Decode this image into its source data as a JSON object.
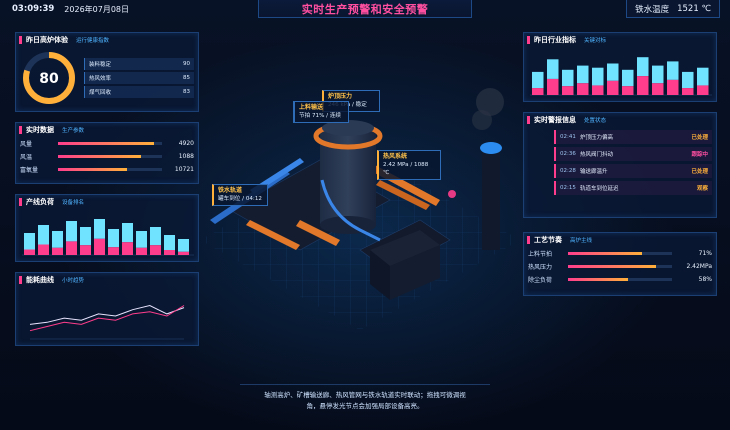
{
  "header": {
    "time": "03:09:39",
    "date": "2026年07月08日",
    "title": "实时生产预警和安全预警",
    "temp_label": "铁水温度",
    "temp_value": "1521 ℃"
  },
  "health": {
    "title": "昨日高炉体验",
    "subtitle": "运行健康指数",
    "score": "80",
    "score_fraction": 0.8,
    "items": [
      {
        "label": "装料稳定",
        "value": "90"
      },
      {
        "label": "热风效率",
        "value": "85"
      },
      {
        "label": "煤气回收",
        "value": "83"
      }
    ]
  },
  "realtime": {
    "title": "实时数据",
    "subtitle": "生产参数",
    "items": [
      {
        "label": "风量",
        "value": "4920",
        "level": 0.92
      },
      {
        "label": "风温",
        "value": "1088",
        "level": 0.8
      },
      {
        "label": "富氧量",
        "value": "10721",
        "level": 0.66
      }
    ]
  },
  "load": {
    "title": "产线负荷",
    "subtitle": "设备排名",
    "bars": [
      0.55,
      0.75,
      0.6,
      0.85,
      0.7,
      0.9,
      0.65,
      0.8,
      0.6,
      0.7,
      0.5,
      0.4
    ],
    "tops": [
      0.25,
      0.35,
      0.3,
      0.4,
      0.35,
      0.45,
      0.3,
      0.4,
      0.3,
      0.35,
      0.25,
      0.2
    ]
  },
  "energy": {
    "title": "能耗曲线",
    "subtitle": "小时趋势",
    "pink": [
      0.15,
      0.25,
      0.35,
      0.3,
      0.45,
      0.4,
      0.55,
      0.6,
      0.5,
      0.75
    ],
    "blue": [
      0.3,
      0.35,
      0.45,
      0.4,
      0.55,
      0.5,
      0.65,
      0.75,
      0.55,
      0.7
    ]
  },
  "industry": {
    "title": "昨日行业指标",
    "subtitle": "关键对标",
    "bars": [
      0.55,
      0.85,
      0.6,
      0.7,
      0.65,
      0.75,
      0.6,
      0.9,
      0.7,
      0.8,
      0.55,
      0.65
    ],
    "tops": [
      0.3,
      0.45,
      0.35,
      0.4,
      0.35,
      0.45,
      0.35,
      0.5,
      0.4,
      0.45,
      0.3,
      0.35
    ]
  },
  "alarms": {
    "title": "实时警报信息",
    "subtitle": "处置状态",
    "items": [
      {
        "time": "02:41",
        "msg": "炉顶压力偏高",
        "status": "已处理",
        "color": "#ffb03a"
      },
      {
        "time": "02:36",
        "msg": "热风阀门抖动",
        "status": "跟踪中",
        "color": "#ff4fa0"
      },
      {
        "time": "02:28",
        "msg": "输送廊温升",
        "status": "已处理",
        "color": "#ffb03a"
      },
      {
        "time": "02:15",
        "msg": "轨道车到位延迟",
        "status": "观察",
        "color": "#ffb03a"
      }
    ]
  },
  "process": {
    "title": "工艺节奏",
    "subtitle": "高炉主线",
    "items": [
      {
        "label": "上料节拍",
        "value": "71%",
        "level": 0.71
      },
      {
        "label": "热风压力",
        "value": "2.42MPa",
        "level": 0.85
      },
      {
        "label": "除尘负荷",
        "value": "58%",
        "level": 0.58
      }
    ]
  },
  "callouts": {
    "top_pressure": {
      "title": "炉顶压力",
      "line1": "246 kPa / 稳定"
    },
    "feed": {
      "title": "上料输送",
      "line1": "节拍 71% / 连续"
    },
    "hot_air": {
      "title": "热风系统",
      "line1": "2.42 MPa / 1088 ℃"
    },
    "rail": {
      "title": "铁水轨道",
      "line1": "罐车到位 / 04:12"
    }
  },
  "footer": {
    "line1": "轴测高炉、矿槽输送廊、热风管网与铁水轨道实时联动；拖拽可微调视",
    "line2": "角，悬停发光节点会加强局部设备高亮。"
  },
  "colors": {
    "accent_pink": "#ff3d8c",
    "accent_orange": "#ffb03a",
    "accent_blue": "#4fb4ff",
    "cyan": "#6fe3ff"
  }
}
